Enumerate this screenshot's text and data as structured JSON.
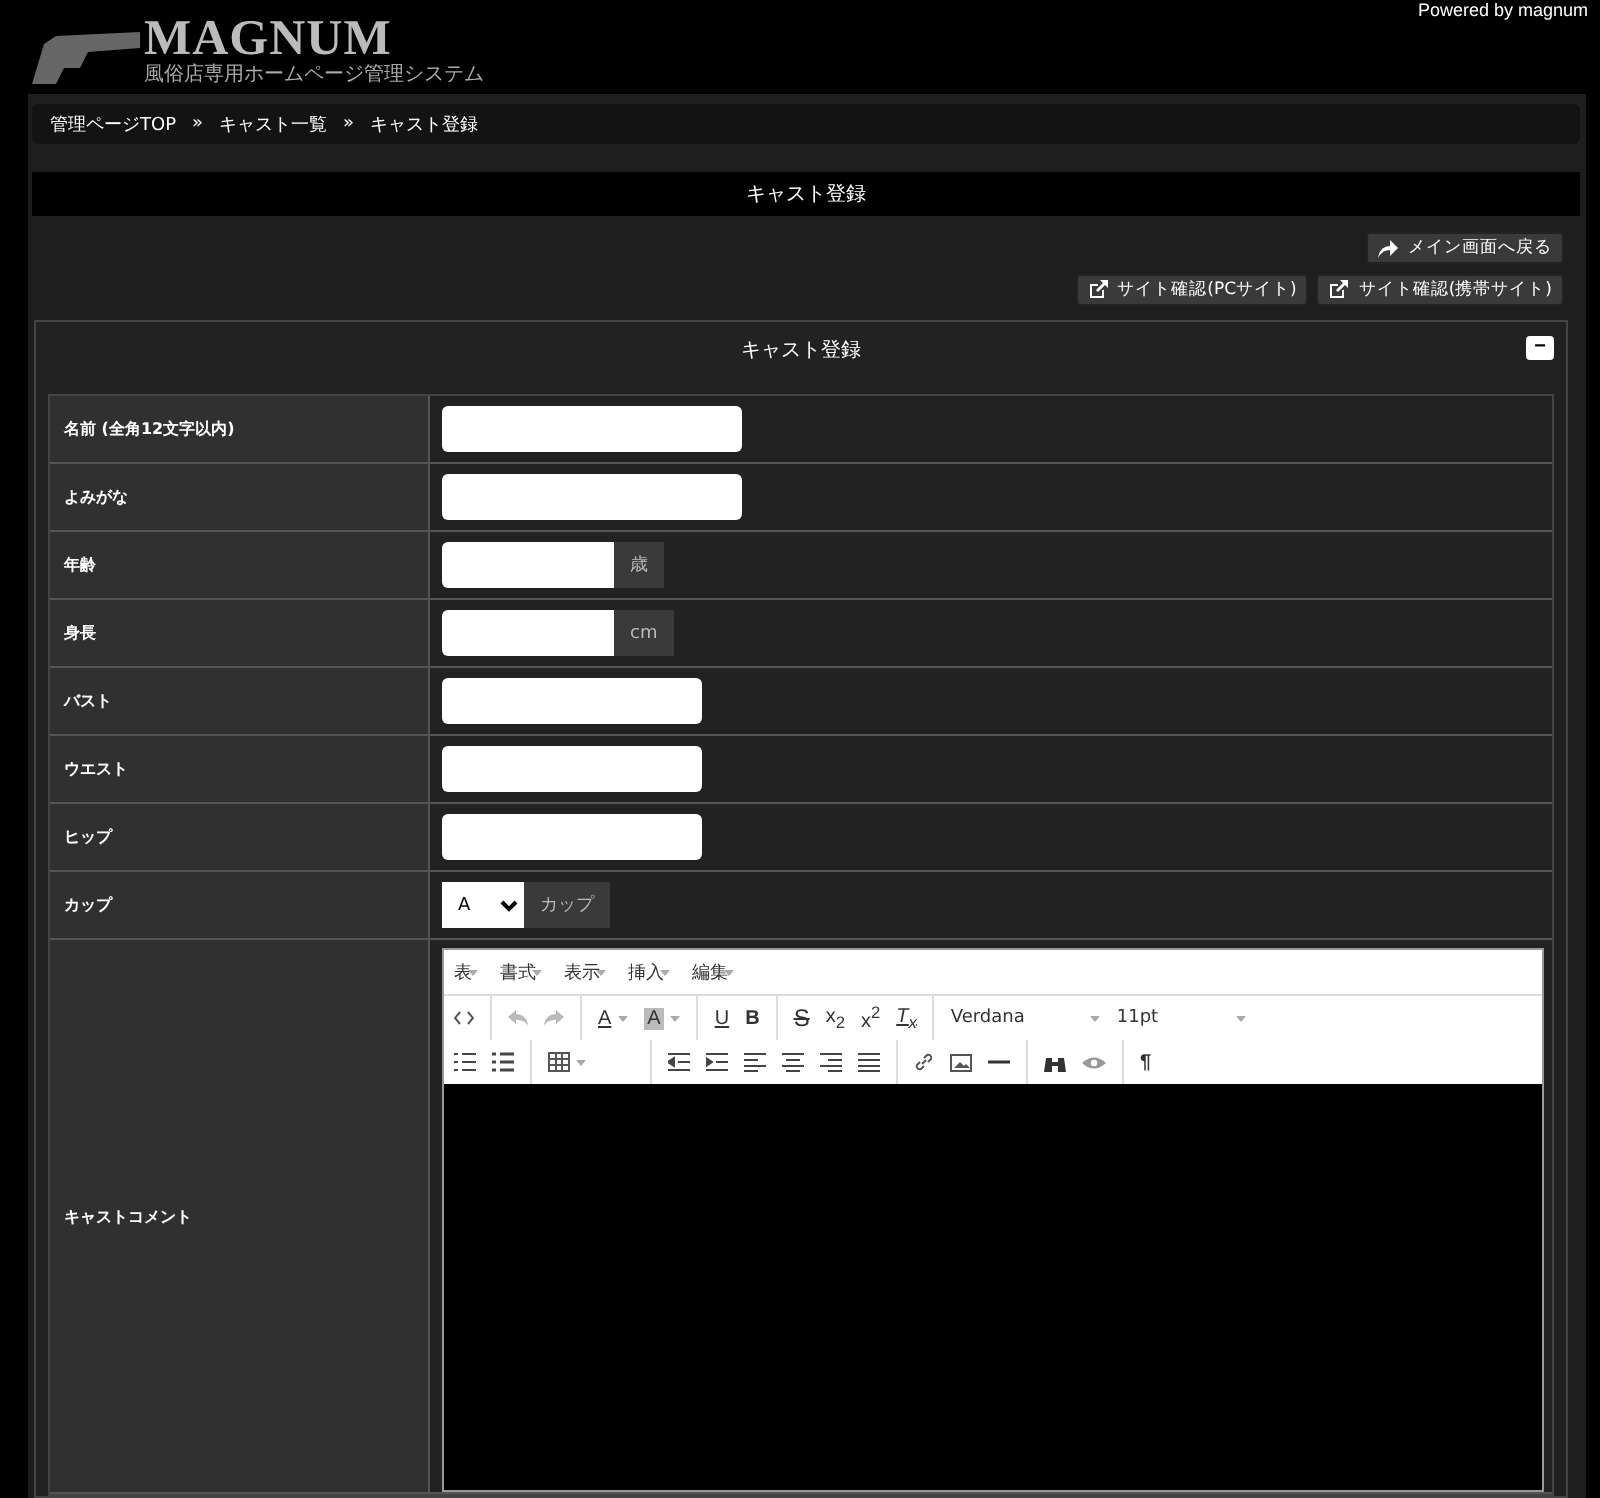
{
  "header": {
    "logo_title": "MAGNUM",
    "logo_subtitle": "風俗店専用ホームページ管理システム",
    "powered_by": "Powered by magnum"
  },
  "breadcrumb": [
    "管理ページTOP",
    "キャスト一覧",
    "キャスト登録"
  ],
  "breadcrumb_separator": "»",
  "page_title": "キャスト登録",
  "back_button": "メイン画面へ戻る",
  "site_buttons": [
    "サイト確認(PCサイト)",
    "サイト確認(携帯サイト)"
  ],
  "panel": {
    "title": "キャスト登録",
    "collapse_button": "−"
  },
  "form_rows": [
    {
      "label": "名前 (全角12文字以内)",
      "kind": "text"
    },
    {
      "label": "よみがな",
      "kind": "text"
    },
    {
      "label": "年齢",
      "kind": "unit",
      "addon": "歳"
    },
    {
      "label": "身長",
      "kind": "unit",
      "addon": "cm"
    },
    {
      "label": "バスト",
      "kind": "measure"
    },
    {
      "label": "ウエスト",
      "kind": "measure"
    },
    {
      "label": "ヒップ",
      "kind": "measure"
    },
    {
      "label": "カップ",
      "kind": "select",
      "value": "A",
      "addon": "カップ"
    },
    {
      "label": "キャストコメント",
      "kind": "editor"
    }
  ],
  "editor": {
    "menu": [
      "表",
      "書式",
      "表示",
      "挿入",
      "編集"
    ],
    "font": "Verdana",
    "size": "11pt",
    "text_buttons": [
      "A",
      "A",
      "U",
      "B",
      "S",
      "x$_{2}$",
      "x$^{2}$",
      "T$_{x}$",
      "¶"
    ]
  }
}
